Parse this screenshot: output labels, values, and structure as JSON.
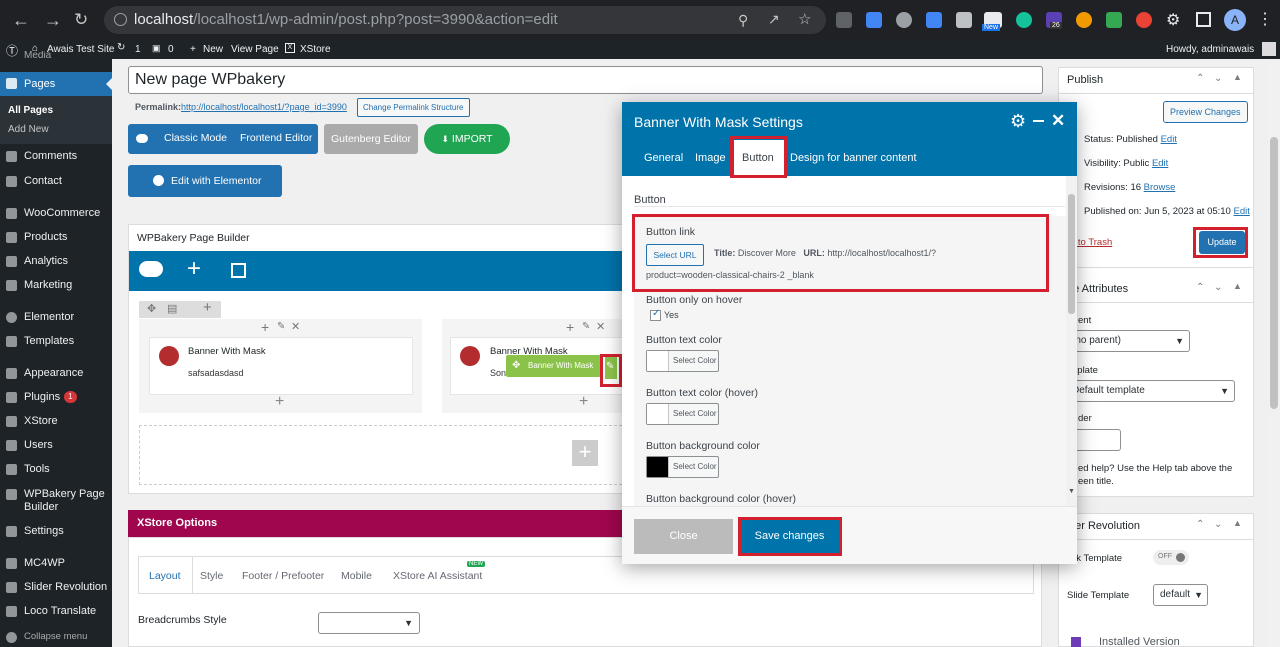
{
  "browser": {
    "url_host": "localhost",
    "url_rest": "/localhost1/wp-admin/post.php?post=3990&action=edit",
    "profile_initial": "A",
    "ext_badge_new": "New",
    "ext_badge_26": "26"
  },
  "adminbar": {
    "site": "Awais Test Site",
    "updates": "1",
    "comments": "0",
    "new": "New",
    "view_page": "View Page",
    "xstore": "XStore",
    "howdy": "Howdy, adminawais"
  },
  "sidebar": {
    "media_cut": "Media",
    "pages": "Pages",
    "all_pages": "All Pages",
    "add_new": "Add New",
    "items": [
      "Comments",
      "Contact",
      "WooCommerce",
      "Products",
      "Analytics",
      "Marketing",
      "Elementor",
      "Templates",
      "Appearance",
      "Plugins",
      "XStore",
      "Users",
      "Tools",
      "WPBakery Page",
      "Builder",
      "Settings",
      "MC4WP",
      "Slider Revolution",
      "Loco Translate",
      "Collapse menu"
    ],
    "plugins_badge": "1"
  },
  "editor": {
    "title": "New page WPbakery",
    "permalink_label": "Permalink:",
    "permalink_url": "http://localhost/localhost1/?page_id=3990",
    "change_permalink": "Change Permalink Structure",
    "classic_mode": "Classic Mode",
    "frontend_editor": "Frontend Editor",
    "gutenberg": "Gutenberg Editor",
    "import": "IMPORT",
    "elementor": "Edit with Elementor",
    "wpb_title": "WPBakery Page Builder",
    "el1_title": "Banner With Mask",
    "el1_text": "safsadasdasd",
    "el2_title": "Banner With Mask",
    "el2_text": "Son",
    "tooltip": "Banner With Mask"
  },
  "xstore": {
    "title": "XStore Options",
    "tabs": [
      "Layout",
      "Style",
      "Footer / Prefooter",
      "Mobile",
      "XStore AI Assistant"
    ],
    "new_badge": "NEW",
    "breadcrumbs_label": "Breadcrumbs Style"
  },
  "modal": {
    "title": "Banner With Mask Settings",
    "tabs": [
      "General",
      "Image",
      "Button",
      "Design for banner content"
    ],
    "section": "Button",
    "button_link_label": "Button link",
    "select_url": "Select URL",
    "link_title_label": "Title:",
    "link_title": "Discover More",
    "link_url_label": "URL:",
    "link_url_1": "http://localhost/localhost1/?",
    "link_url_2": "product=wooden-classical-chairs-2 _blank",
    "hover_label": "Button only on hover",
    "hover_yes": "Yes",
    "text_color_label": "Button text color",
    "text_color_hover_label": "Button text color (hover)",
    "bg_color_label": "Button background color",
    "bg_color_hover_label": "Button background color (hover)",
    "select_color": "Select Color",
    "close": "Close",
    "save": "Save changes",
    "bg_swatch": "#000000"
  },
  "publish": {
    "title": "Publish",
    "preview": "Preview Changes",
    "status": "Status: Published",
    "visibility": "Visibility: Public",
    "revisions": "Revisions: 16",
    "browse": "Browse",
    "published_on": "Published on: Jun 5, 2023 at 05:10",
    "edit": "Edit",
    "trash": "e to Trash",
    "update": "Update"
  },
  "attributes": {
    "title": "ge Attributes",
    "parent_label": "ent",
    "parent_value": "(no parent)",
    "template_label": "nplate",
    "template_value": "Default template",
    "order_label": "der",
    "help_1": "ed help? Use the Help tab above the",
    "help_2": "een title."
  },
  "slider": {
    "title": "der Revolution",
    "blank_label": "nk Template",
    "toggle": "OFF",
    "slide_label": "Slide Template",
    "slide_value": "default",
    "installed": "Installed Version"
  },
  "colors": {
    "wp_blue": "#2271b1",
    "modal_blue": "#0073aa",
    "xstore_bar": "#a0064d",
    "import_green": "#20a653",
    "highlight_red": "#d2202f"
  }
}
